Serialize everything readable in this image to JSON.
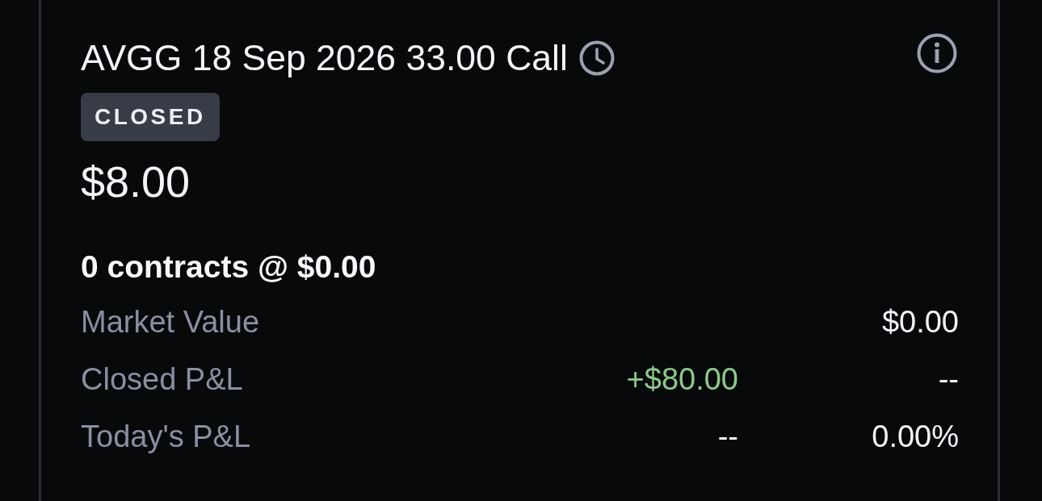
{
  "position": {
    "title": "AVGG 18 Sep 2026 33.00 Call",
    "status": "CLOSED",
    "price": "$8.00",
    "contracts": "0 contracts @ $0.00",
    "rows": [
      {
        "label": "Market Value",
        "column_3": {
          "text": "$0.00",
          "positive": false
        }
      },
      {
        "label": "Closed P&L",
        "column_2": {
          "text": "+$80.00",
          "positive": true
        },
        "column_3": {
          "text": "--",
          "positive": false
        }
      },
      {
        "label": "Today's P&L",
        "column_2": {
          "text": "--",
          "positive": false
        },
        "column_3": {
          "text": "0.00%",
          "positive": false
        }
      }
    ]
  }
}
